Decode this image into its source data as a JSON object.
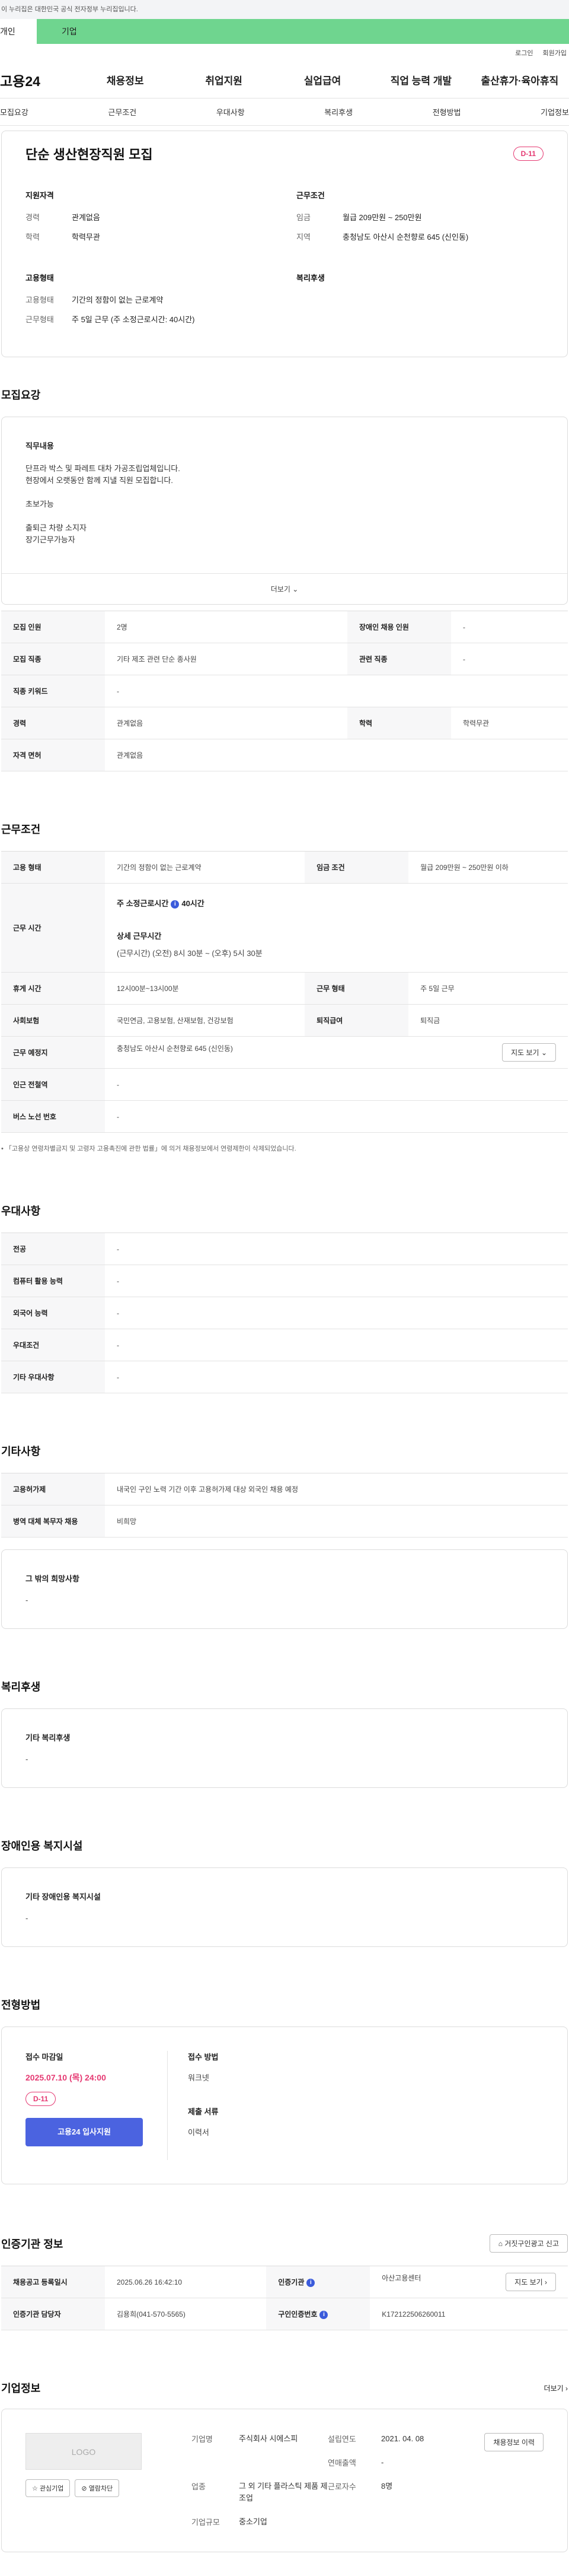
{
  "banner": {
    "text": "이 누리집은 대한민국 공식 전자정부 누리집입니다."
  },
  "user_tabs": {
    "personal": "개인",
    "company": "기업"
  },
  "util": {
    "login": "로그인",
    "join": "회원가입"
  },
  "gnb": {
    "logo": "고용24",
    "items": [
      "채용정보",
      "취업지원",
      "실업급여",
      "직업 능력 개발",
      "출산휴가·육아휴직"
    ]
  },
  "anchor_tabs": [
    "모집요강",
    "근무조건",
    "우대사항",
    "복리후생",
    "전형방법",
    "기업정보"
  ],
  "summary": {
    "title": "단순 생산현장직원 모집",
    "dday": "D-11",
    "qual_title": "지원자격",
    "cond_title": "근무조건",
    "emp_title": "고용형태",
    "welfare_title": "복리후생",
    "career_k": "경력",
    "career_v": "관계없음",
    "edu_k": "학력",
    "edu_v": "학력무관",
    "wage_k": "임금",
    "wage_v": "월급 209만원 ~ 250만원",
    "region_k": "지역",
    "region_v": "충청남도 아산시 순천향로 645 (신인동)",
    "emptype_k": "고용형태",
    "emptype_v": "기간의 정함이 없는 근로계약",
    "worktype_k": "근무형태",
    "worktype_v": "주 5일 근무 (주 소정근로시간: 40시간)"
  },
  "recruit": {
    "title": "모집요강",
    "duty_title": "직무내용",
    "duty_text": "단프라 박스 및 파레트 대차 가공조립업체입니다.\n현장에서 오랫동안 함께 지낼 직원 모집합니다.\n\n초보가능\n\n출퇴근 차량 소지자\n장기근무가능자",
    "more": "더보기",
    "rows": [
      {
        "k1": "모집 인원",
        "v1": "2명",
        "k2": "장애인 채용 인원",
        "v2": "-"
      },
      {
        "k1": "모집 직종",
        "v1": "기타 제조 관련 단순 종사원",
        "k2": "관련 직종",
        "v2": "-"
      },
      {
        "k1": "직종 키워드",
        "v1": "-"
      },
      {
        "k1": "경력",
        "v1": "관계없음",
        "k2": "학력",
        "v2": "학력무관"
      },
      {
        "k1": "자격 면허",
        "v1": "관계없음"
      }
    ]
  },
  "conditions": {
    "title": "근무조건",
    "emptype_k": "고용 형태",
    "emptype_v": "기간의 정함이 없는 근로계약",
    "wage_k": "임금 조건",
    "wage_v": "월급 209만원 ~ 250만원 이하",
    "hours_k": "근무 시간",
    "hours_main_label": "주 소정근로시간",
    "hours_main_val": "40시간",
    "hours_detail_title": "상세 근무시간",
    "hours_detail": "(근무시간) (오전) 8시 30분 ~ (오후) 5시 30분",
    "break_k": "휴게 시간",
    "break_v": "12시00분~13시00분",
    "worktype_k": "근무 형태",
    "worktype_v": "주 5일 근무",
    "insurance_k": "사회보험",
    "insurance_v": "국민연금, 고용보험, 산재보험, 건강보험",
    "severance_k": "퇴직급여",
    "severance_v": "퇴직금",
    "place_k": "근무 예정지",
    "place_v": "충청남도 아산시 순천향로 645 (신인동)",
    "map_btn": "지도 보기",
    "station_k": "인근 전철역",
    "station_v": "-",
    "bus_k": "버스 노선 번호",
    "bus_v": "-",
    "notice": "「고용상 연령차별금지 및 고령자 고용촉진에 관한 법률」에 의거 채용정보에서 연령제한이 삭제되었습니다."
  },
  "preferences": {
    "title": "우대사항",
    "rows": [
      {
        "k": "전공",
        "v": "-"
      },
      {
        "k": "컴퓨터 활용 능력",
        "v": "-"
      },
      {
        "k": "외국어 능력",
        "v": "-"
      },
      {
        "k": "우대조건",
        "v": "-"
      },
      {
        "k": "기타 우대사항",
        "v": "-"
      }
    ]
  },
  "etc": {
    "title": "기타사항",
    "rows": [
      {
        "k": "고용허가제",
        "v": "내국인 구인 노력 기간 이후 고용허가제 대상 외국인 채용 예정"
      },
      {
        "k": "병역 대체 복무자 채용",
        "v": "비희망"
      }
    ],
    "other_title": "그 밖의 희망사항",
    "other_v": "-"
  },
  "welfare": {
    "title": "복리후생",
    "sub": "기타 복리후생",
    "v": "-"
  },
  "disabled": {
    "title": "장애인용 복지시설",
    "sub": "기타 장애인용 복지시설",
    "v": "-"
  },
  "selection": {
    "title": "전형방법",
    "deadline_label": "접수 마감일",
    "deadline": "2025.07.10 (목) 24:00",
    "dday": "D-11",
    "apply_btn": "고용24 입사지원",
    "method_label": "접수 방법",
    "method_v": "워크넷",
    "docs_label": "제출 서류",
    "docs_v": "이력서"
  },
  "agency": {
    "title": "인증기관 정보",
    "report_btn": "거짓구인광고 신고",
    "rows": [
      {
        "k1": "채용공고 등록일시",
        "v1": "2025.06.26 16:42:10",
        "k2": "인증기관",
        "v2": "아산고용센터"
      },
      {
        "k1": "인증기관 담당자",
        "v1": "김용희(041-570-5565)",
        "k2": "구인인증번호",
        "v2": "K172122506260011"
      }
    ],
    "map_btn": "지도 보기"
  },
  "company": {
    "title": "기업정보",
    "more": "더보기",
    "logo_placeholder": "LOGO",
    "fav_btn": "관심기업",
    "block_btn": "열람차단",
    "name_k": "기업명",
    "name_v": "주식회사 시에스피",
    "est_k": "설립연도",
    "est_v": "2021. 04. 08",
    "sales_k": "연매출액",
    "sales_v": "-",
    "industry_k": "업종",
    "industry_v": "그 외 기타 플라스틱 제품 제조업",
    "staff_k": "근로자수",
    "staff_v": "8명",
    "size_k": "기업규모",
    "size_v": "중소기업",
    "jobs_btn": "채용정보 이력"
  }
}
